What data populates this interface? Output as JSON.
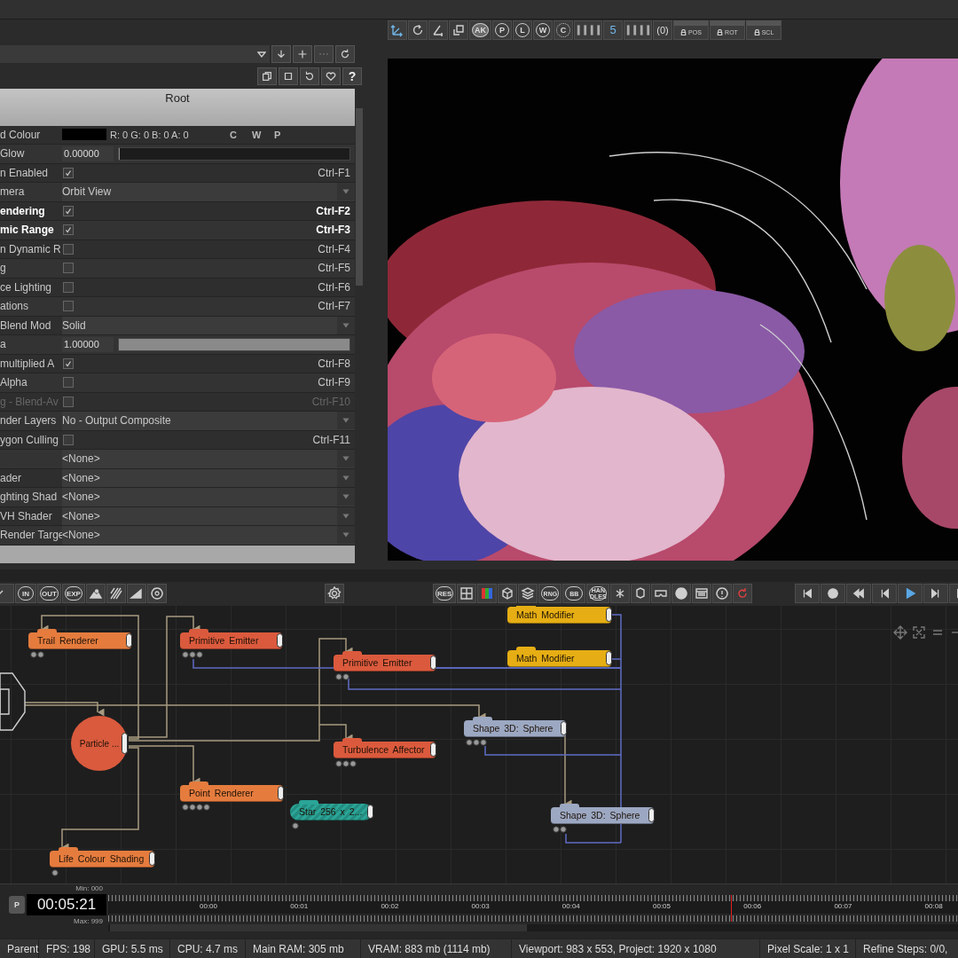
{
  "viewport_toolbar": {
    "gizmos": [
      "AK",
      "P",
      "L",
      "W",
      "C"
    ],
    "step": "5",
    "zero": "(0)",
    "locks": [
      "POS",
      "ROT",
      "SCL"
    ]
  },
  "panel_tools": {
    "help": "?"
  },
  "properties": {
    "title": "Root",
    "rows": [
      {
        "kind": "colour",
        "label": "d Colour",
        "value": "R: 0 G: 0 B: 0 A: 0",
        "channels": [
          "C",
          "W",
          "P"
        ]
      },
      {
        "kind": "slider",
        "label": "Glow",
        "value": "0.00000",
        "level": 0
      },
      {
        "kind": "checkbox",
        "label": "n Enabled",
        "checked": true,
        "highlighted": false,
        "disabled": false,
        "shortcut": "Ctrl-F1"
      },
      {
        "kind": "dropdown",
        "label": "mera",
        "value": "Orbit View"
      },
      {
        "kind": "checkbox",
        "label": "endering",
        "checked": true,
        "highlighted": true,
        "disabled": false,
        "shortcut": "Ctrl-F2"
      },
      {
        "kind": "checkbox",
        "label": "mic Range",
        "checked": true,
        "highlighted": true,
        "disabled": false,
        "shortcut": "Ctrl-F3"
      },
      {
        "kind": "checkbox",
        "label": "n Dynamic R",
        "checked": false,
        "highlighted": false,
        "disabled": false,
        "shortcut": "Ctrl-F4"
      },
      {
        "kind": "checkbox",
        "label": "g",
        "checked": false,
        "highlighted": false,
        "disabled": false,
        "shortcut": "Ctrl-F5"
      },
      {
        "kind": "checkbox",
        "label": "ce Lighting",
        "checked": false,
        "highlighted": false,
        "disabled": false,
        "shortcut": "Ctrl-F6"
      },
      {
        "kind": "checkbox",
        "label": "ations",
        "checked": false,
        "highlighted": false,
        "disabled": false,
        "shortcut": "Ctrl-F7"
      },
      {
        "kind": "dropdown",
        "label": "Blend Mod",
        "value": "Solid"
      },
      {
        "kind": "slider",
        "label": "a",
        "value": "1.00000",
        "level": 1
      },
      {
        "kind": "checkbox",
        "label": "multiplied A",
        "checked": true,
        "highlighted": false,
        "disabled": false,
        "shortcut": "Ctrl-F8"
      },
      {
        "kind": "checkbox",
        "label": "Alpha",
        "checked": false,
        "highlighted": false,
        "disabled": false,
        "shortcut": "Ctrl-F9"
      },
      {
        "kind": "checkbox",
        "label": "g - Blend-Av",
        "checked": false,
        "highlighted": false,
        "disabled": true,
        "shortcut": "Ctrl-F10"
      },
      {
        "kind": "dropdown",
        "label": "nder Layers",
        "value": "No - Output Composite"
      },
      {
        "kind": "checkbox",
        "label": "ygon Culling",
        "checked": false,
        "highlighted": false,
        "disabled": false,
        "shortcut": "Ctrl-F11"
      },
      {
        "kind": "dropdown",
        "value": "<None>"
      },
      {
        "kind": "dropdown",
        "label": "ader",
        "value": "<None>"
      },
      {
        "kind": "dropdown",
        "label": "ghting Shad",
        "value": "<None>"
      },
      {
        "kind": "dropdown",
        "label": "VH Shader",
        "value": "<None>"
      },
      {
        "kind": "dropdown",
        "label": "Render Targe",
        "value": "<None>"
      }
    ]
  },
  "graph_toolbar": {
    "left_buttons": [
      "IN",
      "OUT",
      "EXP"
    ],
    "center_buttons": [
      "RES",
      "RNG",
      "BB",
      "HAN DLES"
    ]
  },
  "nodes": [
    {
      "label": "Math Modifier",
      "kind": "modifier"
    },
    {
      "label": "Trail Renderer",
      "kind": "renderer"
    },
    {
      "label": "Primitive Emitter",
      "kind": "emitter"
    },
    {
      "label": "Math Modifier",
      "kind": "modifier"
    },
    {
      "label": "Primitive Emitter",
      "kind": "emitter"
    },
    {
      "label": "Particle ...",
      "kind": "particle"
    },
    {
      "label": "Shape 3D: Sphere",
      "kind": "geometry"
    },
    {
      "label": "Turbulence Affector",
      "kind": "emitter"
    },
    {
      "label": "Point Renderer",
      "kind": "renderer"
    },
    {
      "label": "Star 256 x 2...",
      "kind": "resource"
    },
    {
      "label": "Shape 3D: Sphere",
      "kind": "geometry"
    },
    {
      "label": "Life Colour Shading",
      "kind": "renderer"
    }
  ],
  "timeline": {
    "button": "P",
    "time": "00:05:21",
    "min": "Min: 000",
    "max": "Max: 999",
    "ticks": [
      "00:00",
      "00:01",
      "00:02",
      "00:03",
      "00:04",
      "00:05",
      "00:06",
      "00:07",
      "00:08"
    ],
    "level": 0.7
  },
  "status_bar": [
    "Parent",
    "FPS: 198",
    "GPU: 5.5 ms",
    "CPU: 4.7 ms",
    "Main RAM: 305 mb",
    "VRAM: 883 mb (1114 mb)",
    "Viewport: 983 x 553, Project: 1920 x 1080",
    "Pixel Scale: 1 x 1",
    "Refine Steps: 0/0,"
  ]
}
